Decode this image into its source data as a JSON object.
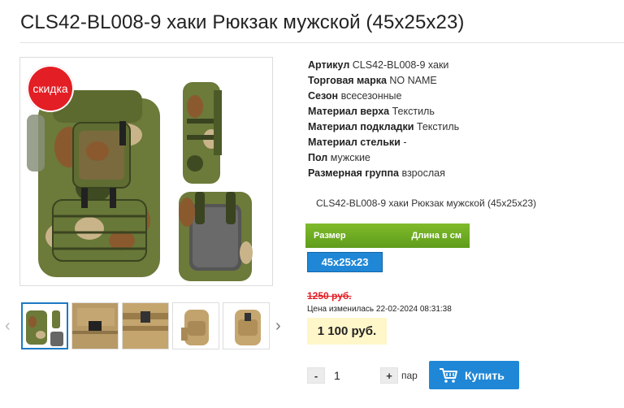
{
  "product": {
    "title": "CLS42-BL008-9 хаки Рюкзак мужской (45х25х23)",
    "sale_badge": "скидка",
    "description": "CLS42-BL008-9 хаки Рюкзак мужской (45х25х23)"
  },
  "specs": [
    {
      "key": "Артикул",
      "value": "CLS42-BL008-9 хаки"
    },
    {
      "key": "Торговая марка",
      "value": "NO NAME"
    },
    {
      "key": "Сезон",
      "value": "всесезонные"
    },
    {
      "key": "Материал верха",
      "value": "Текстиль"
    },
    {
      "key": "Материал подкладки",
      "value": "Текстиль"
    },
    {
      "key": "Материал стельки",
      "value": "-"
    },
    {
      "key": "Пол",
      "value": "мужские"
    },
    {
      "key": "Размерная группа",
      "value": "взрослая"
    }
  ],
  "size_selector": {
    "header_label": "Размер",
    "header_right": "Длина в см",
    "selected": "45x25x23"
  },
  "pricing": {
    "old_price": "1250 руб.",
    "change_note": "Цена изменилась 22-02-2024 08:31:38",
    "current_price": "1 100 руб."
  },
  "quantity": {
    "minus": "-",
    "value": "1",
    "plus": "+",
    "unit": "пар"
  },
  "buy_button": {
    "label": "Купить"
  },
  "gallery": {
    "thumb_count": 5,
    "left_arrow": "‹",
    "right_arrow": "›"
  },
  "colors": {
    "accent_blue": "#1f87d6",
    "sale_red": "#e31e24",
    "size_green": "#6fab22",
    "price_bg": "#fff6c9"
  }
}
